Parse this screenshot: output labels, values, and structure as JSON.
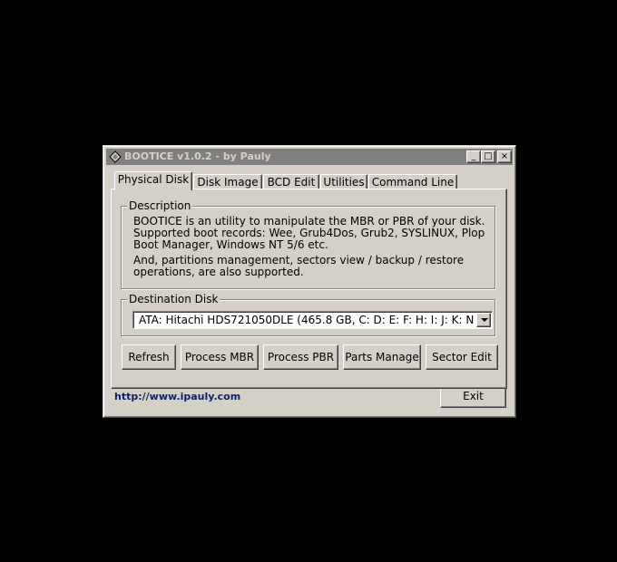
{
  "window": {
    "title": "BOOTICE v1.0.2 - by Pauly",
    "controls": {
      "minimize": "_",
      "maximize": "□",
      "close": "×"
    }
  },
  "tabs": [
    {
      "label": "Physical Disk",
      "active": true
    },
    {
      "label": "Disk Image",
      "active": false
    },
    {
      "label": "BCD Edit",
      "active": false
    },
    {
      "label": "Utilities",
      "active": false
    },
    {
      "label": "Command Line",
      "active": false
    }
  ],
  "description": {
    "label": "Description",
    "lines": [
      "BOOTICE is an utility to manipulate the MBR or PBR of your disk.",
      "Supported boot records: Wee, Grub4Dos, Grub2, SYSLINUX, Plop",
      "Boot Manager, Windows NT 5/6 etc.",
      "And, partitions management, sectors view / backup / restore",
      "operations, are also supported."
    ]
  },
  "destination": {
    "label": "Destination Disk",
    "selected": "ATA: Hitachi HDS721050DLE (465.8 GB, C: D: E: F: H: I: J: K: N"
  },
  "actions": {
    "refresh": "Refresh",
    "process_mbr": "Process MBR",
    "process_pbr": "Process PBR",
    "parts_manage": "Parts Manage",
    "sector_edit": "Sector Edit"
  },
  "footer": {
    "link": "http://www.ipauly.com",
    "exit": "Exit"
  }
}
